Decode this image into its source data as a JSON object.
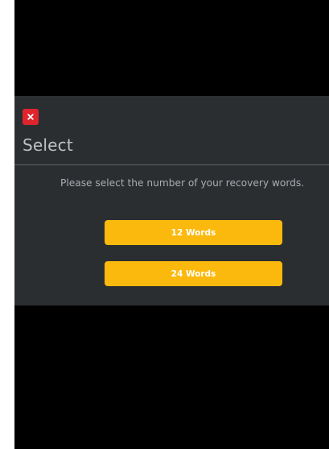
{
  "dialog": {
    "title": "Select",
    "message": "Please select the number of your recovery words.",
    "close_icon": "close-icon",
    "options": [
      {
        "label": "12 Words"
      },
      {
        "label": "24 Words"
      }
    ]
  },
  "colors": {
    "background": "#000000",
    "dialog_background": "#2b2e31",
    "close_button": "#e0242e",
    "option_button": "#fbb90d",
    "option_text": "#ffffff",
    "title_text": "#bfc2c5",
    "message_text": "#a9adb1"
  }
}
